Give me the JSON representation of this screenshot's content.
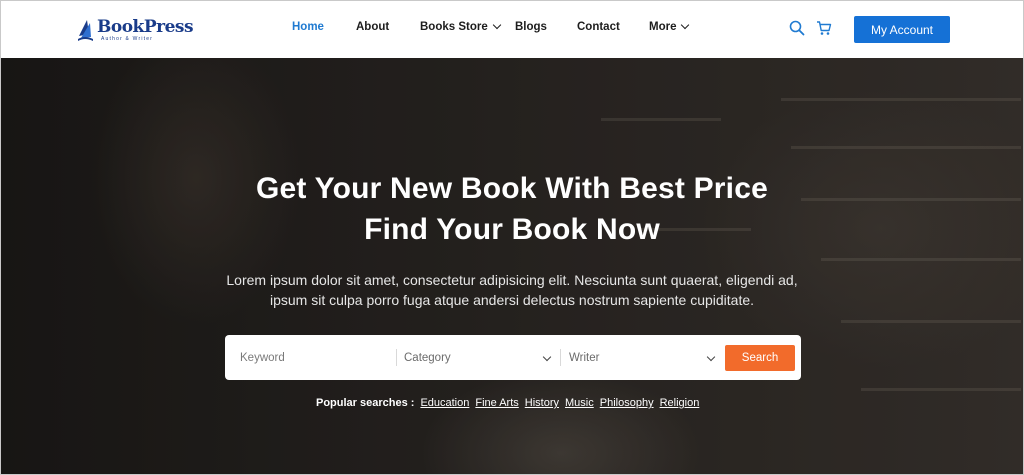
{
  "brand": {
    "name": "BookPress",
    "tagline": "Author & Writer",
    "color": "#1a3c8a"
  },
  "nav": {
    "items": [
      {
        "label": "Home",
        "active": true,
        "dropdown": false
      },
      {
        "label": "About",
        "active": false,
        "dropdown": false
      },
      {
        "label": "Books Store",
        "active": false,
        "dropdown": true
      },
      {
        "label": "Blogs",
        "active": false,
        "dropdown": false
      },
      {
        "label": "Contact",
        "active": false,
        "dropdown": false
      },
      {
        "label": "More",
        "active": false,
        "dropdown": true
      }
    ],
    "active_color": "#1f7ad1"
  },
  "header_actions": {
    "search_icon": "search-icon",
    "cart_icon": "cart-icon",
    "account_label": "My Account",
    "account_color": "#1571d6"
  },
  "hero": {
    "title_line1": "Get Your New Book With Best Price",
    "title_line2": "Find Your Book Now",
    "description": "Lorem ipsum dolor sit amet, consectetur adipisicing elit. Nesciunta sunt quaerat, eligendi ad, ipsum sit culpa porro fuga atque andersi delectus nostrum sapiente cupiditate."
  },
  "search": {
    "keyword_placeholder": "Keyword",
    "category_value": "Category",
    "writer_value": "Writer",
    "button_label": "Search",
    "button_color": "#f26b2b"
  },
  "popular": {
    "label": "Popular searches :",
    "links": [
      "Education",
      "Fine Arts",
      "History",
      "Music",
      "Philosophy",
      "Religion"
    ]
  }
}
